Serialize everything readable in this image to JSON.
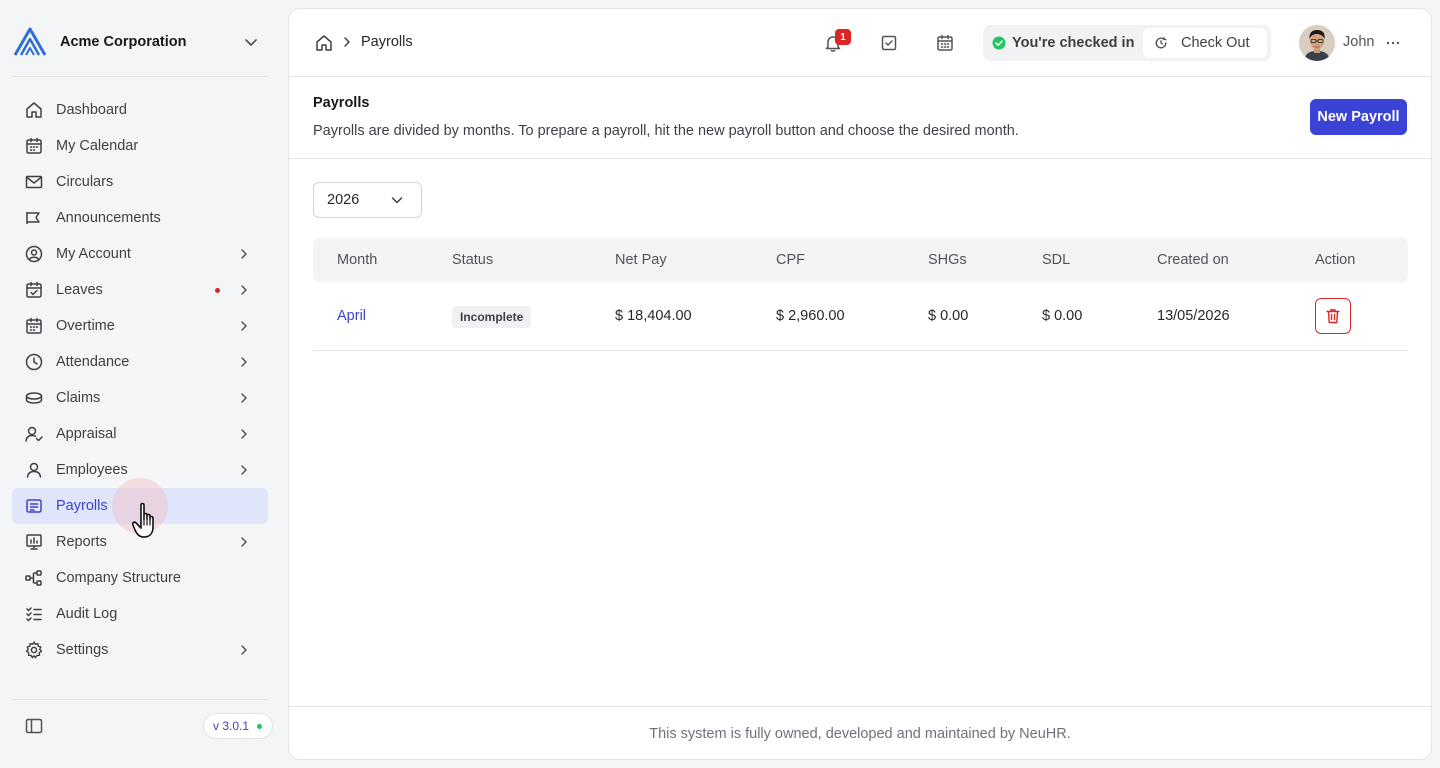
{
  "org": {
    "name": "Acme Corporation"
  },
  "sidebar": {
    "items": [
      {
        "label": "Dashboard",
        "icon": "home-icon"
      },
      {
        "label": "My Calendar",
        "icon": "calendar-icon"
      },
      {
        "label": "Circulars",
        "icon": "mail-icon"
      },
      {
        "label": "Announcements",
        "icon": "megaphone-icon"
      },
      {
        "label": "My Account",
        "icon": "user-circle-icon"
      },
      {
        "label": "Leaves",
        "icon": "calendar-check-icon"
      },
      {
        "label": "Overtime",
        "icon": "calendar-icon"
      },
      {
        "label": "Attendance",
        "icon": "clock-icon"
      },
      {
        "label": "Claims",
        "icon": "coins-icon"
      },
      {
        "label": "Appraisal",
        "icon": "user-check-icon"
      },
      {
        "label": "Employees",
        "icon": "user-icon"
      },
      {
        "label": "Payrolls",
        "icon": "receipt-icon"
      },
      {
        "label": "Reports",
        "icon": "chart-icon"
      },
      {
        "label": "Company Structure",
        "icon": "org-chart-icon"
      },
      {
        "label": "Audit Log",
        "icon": "list-check-icon"
      },
      {
        "label": "Settings",
        "icon": "gear-icon"
      }
    ],
    "active": "Payrolls",
    "version": "v 3.0.1"
  },
  "topbar": {
    "breadcrumb": "Payrolls",
    "notification_count": "1",
    "checkin_status": "You're checked in",
    "checkout_label": "Check Out",
    "user_name": "John"
  },
  "page": {
    "title": "Payrolls",
    "description": "Payrolls are divided by months. To prepare a payroll, hit the new payroll button and choose the desired month.",
    "new_button": "New Payroll",
    "year": "2026"
  },
  "table": {
    "columns": [
      "Month",
      "Status",
      "Net Pay",
      "CPF",
      "SHGs",
      "SDL",
      "Created on",
      "Action"
    ],
    "rows": [
      {
        "month": "April",
        "status": "Incomplete",
        "net_pay": "$ 18,404.00",
        "cpf": "$ 2,960.00",
        "shgs": "$ 0.00",
        "sdl": "$ 0.00",
        "created_on": "13/05/2026"
      }
    ]
  },
  "footer": {
    "text": "This system is fully owned, developed and maintained by NeuHR."
  },
  "colors": {
    "accent": "#3b43d6",
    "active_bg": "#e0e5fb",
    "danger": "#dc2626",
    "success": "#22c55e"
  }
}
